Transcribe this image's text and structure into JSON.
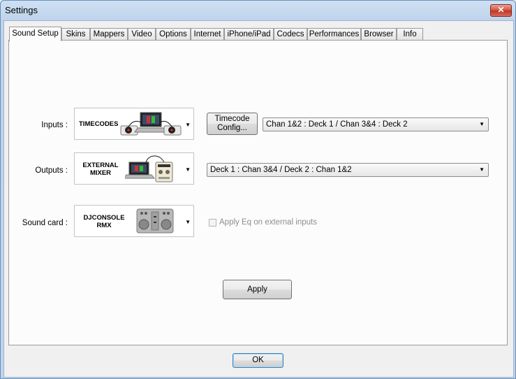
{
  "window": {
    "title": "Settings",
    "close_glyph": "✕"
  },
  "tabs": [
    {
      "label": "Sound Setup",
      "active": true
    },
    {
      "label": "Skins"
    },
    {
      "label": "Mappers"
    },
    {
      "label": "Video"
    },
    {
      "label": "Options"
    },
    {
      "label": "Internet"
    },
    {
      "label": "iPhone/iPad"
    },
    {
      "label": "Codecs"
    },
    {
      "label": "Performances"
    },
    {
      "label": "Browser"
    },
    {
      "label": "Info"
    }
  ],
  "sound_setup": {
    "inputs": {
      "label": "Inputs :",
      "selected": "TIMECODES",
      "icon": "turntables-laptop-icon"
    },
    "timecode_config": {
      "line1": "Timecode",
      "line2": "Config..."
    },
    "inputs_routing": {
      "value": "Chan 1&2 : Deck 1 / Chan 3&4 : Deck 2"
    },
    "outputs": {
      "label": "Outputs :",
      "selected_line1": "EXTERNAL",
      "selected_line2": "MIXER",
      "icon": "laptop-mixer-icon"
    },
    "outputs_routing": {
      "value": "Deck 1 : Chan 3&4 / Deck 2 : Chan 1&2"
    },
    "sound_card": {
      "label": "Sound card :",
      "selected_line1": "DJCONSOLE",
      "selected_line2": "RMX",
      "icon": "dj-controller-icon"
    },
    "apply_eq": {
      "label": "Apply Eq on external inputs",
      "checked": false,
      "enabled": false
    },
    "apply_button": "Apply"
  },
  "footer": {
    "ok_button": "OK"
  },
  "colors": {
    "accent_red": "#c8321f",
    "frame_blue": "#bfd4ec"
  }
}
